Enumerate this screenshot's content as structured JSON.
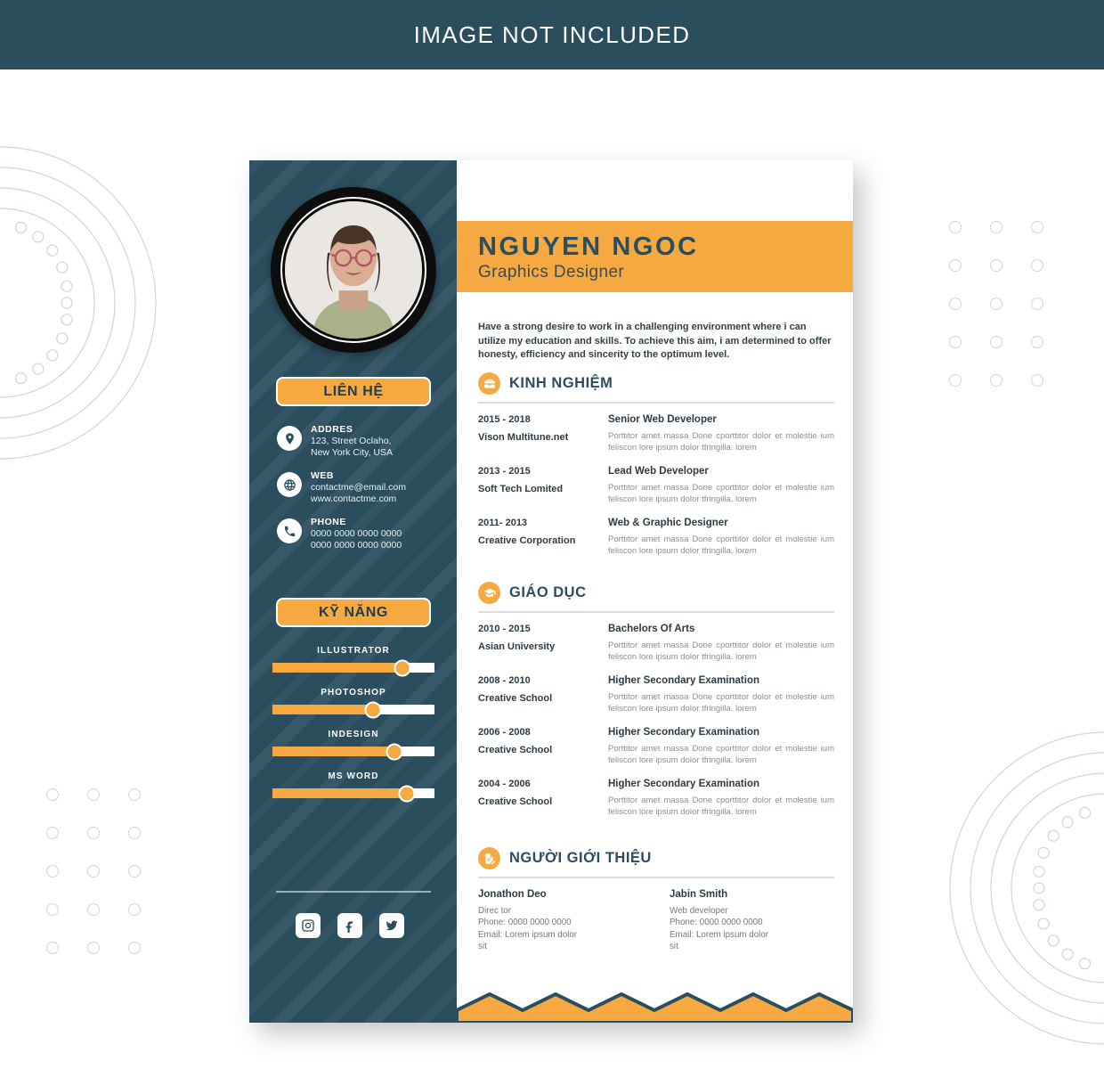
{
  "banner": {
    "text": "IMAGE NOT INCLUDED"
  },
  "header": {
    "name": "NGUYEN NGOC",
    "role": "Graphics Designer",
    "summary": "Have a strong desire to work in a challenging environment where i can utilize my education and skills. To achieve this aim, i am determined to offer honesty, efficiency and sincerity to the optimum level."
  },
  "sidebar": {
    "contact_heading": "LIÊN HỆ",
    "skills_heading": "KỸ NĂNG",
    "contacts": [
      {
        "icon": "location-pin-icon",
        "label": "ADDRES",
        "lines": [
          "123, Street Oclaho,",
          "New York City, USA"
        ]
      },
      {
        "icon": "globe-icon",
        "label": "WEB",
        "lines": [
          "contactme@email.com",
          "www.contactme.com"
        ]
      },
      {
        "icon": "phone-icon",
        "label": "PHONE",
        "lines": [
          "0000 0000 0000 0000",
          "0000 0000 0000 0000"
        ]
      }
    ],
    "skills": [
      {
        "name": "ILLUSTRATOR",
        "value": 80
      },
      {
        "name": "PHOTOSHOP",
        "value": 62
      },
      {
        "name": "INDESIGN",
        "value": 75
      },
      {
        "name": "MS WORD",
        "value": 83
      }
    ],
    "socials": [
      {
        "icon": "instagram-icon",
        "label": "Instagram"
      },
      {
        "icon": "facebook-icon",
        "label": "Facebook"
      },
      {
        "icon": "twitter-icon",
        "label": "Twitter"
      }
    ]
  },
  "experience": {
    "title": "KINH NGHIỆM",
    "icon": "briefcase-icon",
    "entries": [
      {
        "date": "2015 - 2018",
        "org": "Vison Multitune.net",
        "role": "Senior Web Developer",
        "desc": "Porttitor amet massa Done cporttitor dolor et molestie ium feliscon lore ipsum dolor tfringilla. lorem"
      },
      {
        "date": "2013 - 2015",
        "org": "Soft Tech Lomited",
        "role": "Lead Web Developer",
        "desc": "Porttitor amet massa Done cporttitor dolor et molestie ium feliscon lore ipsum dolor tfringilla. lorem"
      },
      {
        "date": "2011- 2013",
        "org": "Creative Corporation",
        "role": "Web & Graphic Designer",
        "desc": "Porttitor amet massa Done cporttitor dolor et molestie ium feliscon lore ipsum dolor tfringilla. lorem"
      }
    ]
  },
  "education": {
    "title": "GIÁO DỤC",
    "icon": "graduation-cap-icon",
    "entries": [
      {
        "date": "2010 - 2015",
        "org": "Asian University",
        "role": "Bachelors Of Arts",
        "desc": "Porttitor amet massa Done cporttitor dolor et molestie ium feliscon lore ipsum dolor tfringilla. lorem"
      },
      {
        "date": "2008 - 2010",
        "org": "Creative School",
        "role": "Higher Secondary Examination",
        "desc": "Porttitor amet massa Done cporttitor dolor et molestie ium feliscon lore ipsum dolor tfringilla. lorem"
      },
      {
        "date": "2006 - 2008",
        "org": "Creative School",
        "role": "Higher Secondary Examination",
        "desc": "Porttitor amet massa Done cporttitor dolor et molestie ium feliscon lore ipsum dolor tfringilla. lorem"
      },
      {
        "date": "2004 - 2006",
        "org": "Creative School",
        "role": "Higher Secondary Examination",
        "desc": "Porttitor amet massa Done cporttitor dolor et molestie ium feliscon lore ipsum dolor tfringilla. lorem"
      }
    ]
  },
  "references": {
    "title": "NGƯỜI GIỚI THIỆU",
    "icon": "document-edit-icon",
    "people": [
      {
        "name": "Jonathon Deo",
        "lines": [
          "Direc tor",
          "Phone: 0000 0000 0000",
          "Email: Lorem ipsum dolor",
          "sit"
        ]
      },
      {
        "name": "Jabin Smith",
        "lines": [
          "Web developer",
          "Phone: 0000 0000 0000",
          "Email: Lorem ipsum dolor",
          "sit"
        ]
      }
    ]
  },
  "colors": {
    "teal": "#2B4E5F",
    "orange": "#F5A940",
    "white": "#FFFFFF",
    "body_text": "#2E3B44",
    "muted_text": "#868F96",
    "deco_line": "#CCD6DD"
  }
}
